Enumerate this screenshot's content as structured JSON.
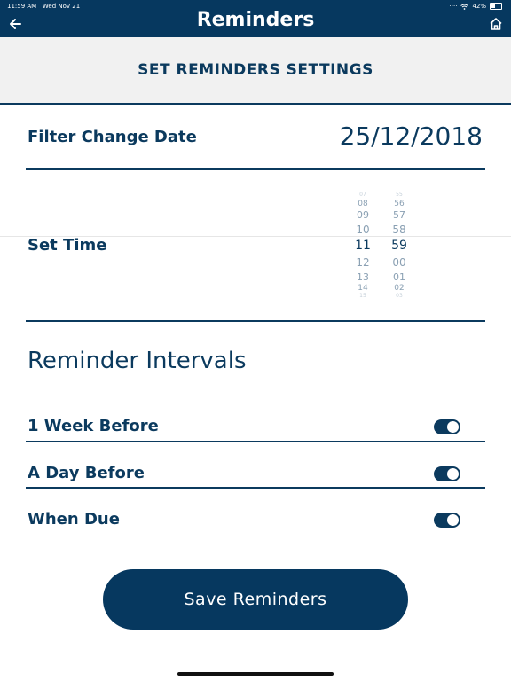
{
  "status": {
    "time": "11:59 AM",
    "date": "Wed Nov 21",
    "battery": "42%"
  },
  "nav": {
    "title": "Reminders",
    "back_icon": "arrow-left-icon",
    "home_icon": "home-icon"
  },
  "header": {
    "title": "SET REMINDERS SETTINGS"
  },
  "filter": {
    "label": "Filter Change Date",
    "value": "25/12/2018"
  },
  "time": {
    "label": "Set Time",
    "hours": [
      "07",
      "08",
      "09",
      "10",
      "11",
      "12",
      "13",
      "14",
      "15"
    ],
    "minutes": [
      "55",
      "56",
      "57",
      "58",
      "59",
      "00",
      "01",
      "02",
      "03"
    ],
    "selected_hour": "11",
    "selected_minute": "59"
  },
  "intervals": {
    "title": "Reminder Intervals",
    "items": [
      {
        "label": "1 Week Before",
        "on": true
      },
      {
        "label": "A Day Before",
        "on": true
      },
      {
        "label": "When Due",
        "on": true
      }
    ]
  },
  "save": {
    "label": "Save Reminders"
  },
  "colors": {
    "primary": "#06385f",
    "text": "#0b3a5e",
    "band": "#f1f1f1"
  }
}
